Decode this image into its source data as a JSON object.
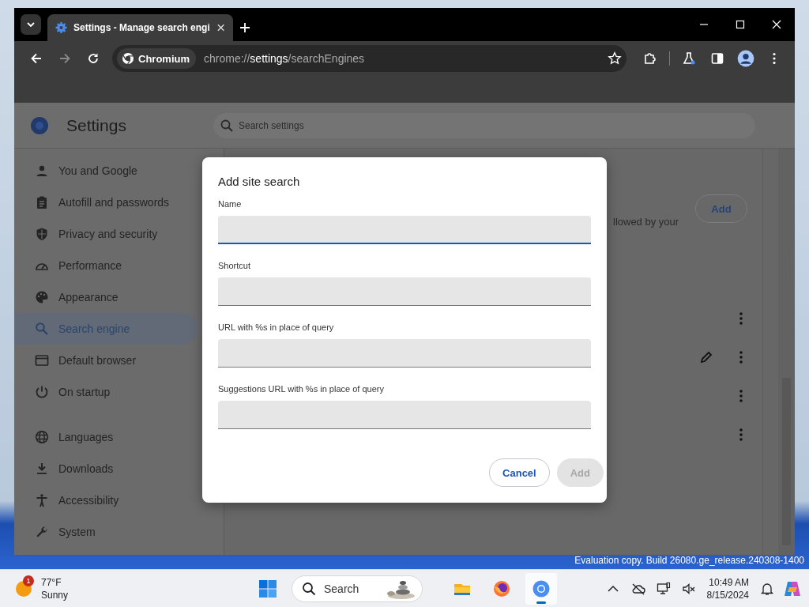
{
  "browser": {
    "tabs": [
      {
        "title": "Settings - Manage search engi",
        "selected": true
      }
    ],
    "nav": {
      "back_enabled": true,
      "forward_enabled": false
    },
    "omnibox": {
      "chip": "Chromium",
      "url_scheme": "chrome://",
      "url_host": "settings",
      "url_path": "/searchEngines"
    }
  },
  "settings": {
    "title": "Settings",
    "search": {
      "placeholder": "Search settings"
    },
    "sidebar": {
      "items": [
        {
          "label": "You and Google",
          "selected": false
        },
        {
          "label": "Autofill and passwords",
          "selected": false
        },
        {
          "label": "Privacy and security",
          "selected": false
        },
        {
          "label": "Performance",
          "selected": false
        },
        {
          "label": "Appearance",
          "selected": false
        },
        {
          "label": "Search engine",
          "selected": true
        },
        {
          "label": "Default browser",
          "selected": false
        },
        {
          "label": "On startup",
          "selected": false
        },
        {
          "label": "Languages",
          "selected": false
        },
        {
          "label": "Downloads",
          "selected": false
        },
        {
          "label": "Accessibility",
          "selected": false
        },
        {
          "label": "System",
          "selected": false
        }
      ]
    },
    "content": {
      "add_button": "Add",
      "partial_text": "llowed by your",
      "rows": [
        {
          "editable": false
        },
        {
          "editable": true
        },
        {
          "editable": false
        },
        {
          "editable": false
        }
      ]
    }
  },
  "dialog": {
    "title": "Add site search",
    "fields": [
      {
        "label": "Name",
        "focused": true
      },
      {
        "label": "Shortcut",
        "focused": false
      },
      {
        "label": "URL with %s in place of query",
        "focused": false
      },
      {
        "label": "Suggestions URL with %s in place of query",
        "focused": false
      }
    ],
    "buttons": [
      {
        "label": "Cancel",
        "disabled": false
      },
      {
        "label": "Add",
        "disabled": true
      }
    ]
  },
  "desktop": {
    "build_text": "Evaluation copy. Build 26080.ge_release.240308-1400"
  },
  "taskbar": {
    "weather": {
      "badge": "1",
      "temperature": "77°F",
      "condition": "Sunny"
    },
    "search": {
      "placeholder": "Search"
    },
    "apps": [
      {
        "kind": "files",
        "active": false
      },
      {
        "kind": "firefox",
        "active": false
      },
      {
        "kind": "chromium",
        "active": true
      }
    ],
    "clock": {
      "time": "10:49 AM",
      "date": "8/15/2024"
    }
  }
}
